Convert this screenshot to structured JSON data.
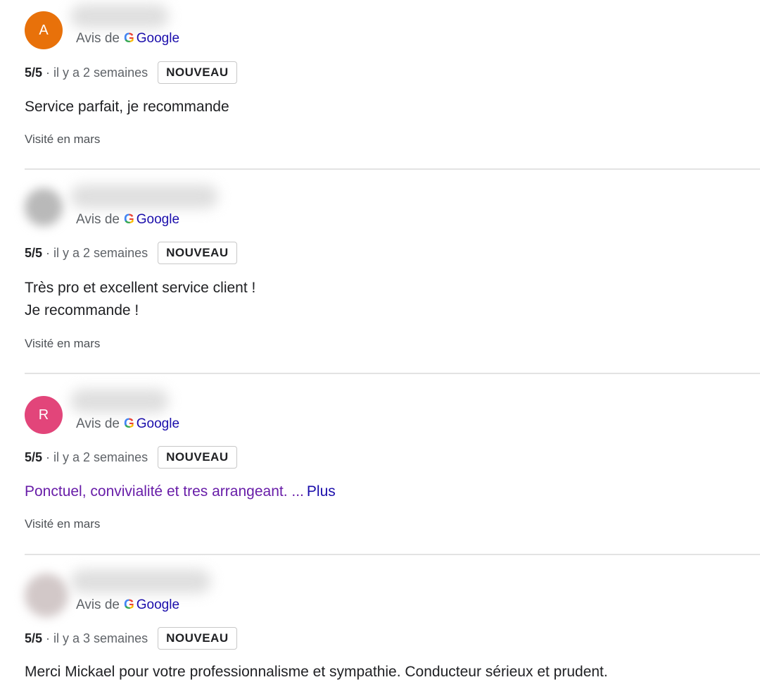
{
  "reviews": [
    {
      "avatar_letter": "A",
      "avatar_color": "#e8710a",
      "source_prefix": "Avis de",
      "source_icon": "G",
      "source_name": "Google",
      "rating": "5/5",
      "time": "· il y a 2 semaines",
      "badge": "NOUVEAU",
      "text_lines": [
        "Service parfait, je recommande"
      ],
      "visited": "Visité en mars"
    },
    {
      "avatar_letter": "",
      "avatar_color": "#b9b9b9",
      "source_prefix": "Avis de",
      "source_icon": "G",
      "source_name": "Google",
      "rating": "5/5",
      "time": "· il y a 2 semaines",
      "badge": "NOUVEAU",
      "text_lines": [
        "Très pro et excellent service client !",
        "Je recommande !"
      ],
      "visited": "Visité en mars"
    },
    {
      "avatar_letter": "R",
      "avatar_color": "#e2457a",
      "source_prefix": "Avis de",
      "source_icon": "G",
      "source_name": "Google",
      "rating": "5/5",
      "time": "· il y a 2 semaines",
      "badge": "NOUVEAU",
      "text": "Ponctuel, convivialité et tres arrangeant. ...",
      "more": "Plus",
      "visited": "Visité en mars"
    },
    {
      "avatar_letter": "",
      "avatar_color": "#d2c8c8",
      "source_prefix": "Avis de",
      "source_icon": "G",
      "source_name": "Google",
      "rating": "5/5",
      "time": "· il y a 3 semaines",
      "badge": "NOUVEAU",
      "text_lines": [
        "Merci Mickael pour votre professionnalisme et sympathie. Conducteur sérieux et prudent."
      ]
    }
  ]
}
